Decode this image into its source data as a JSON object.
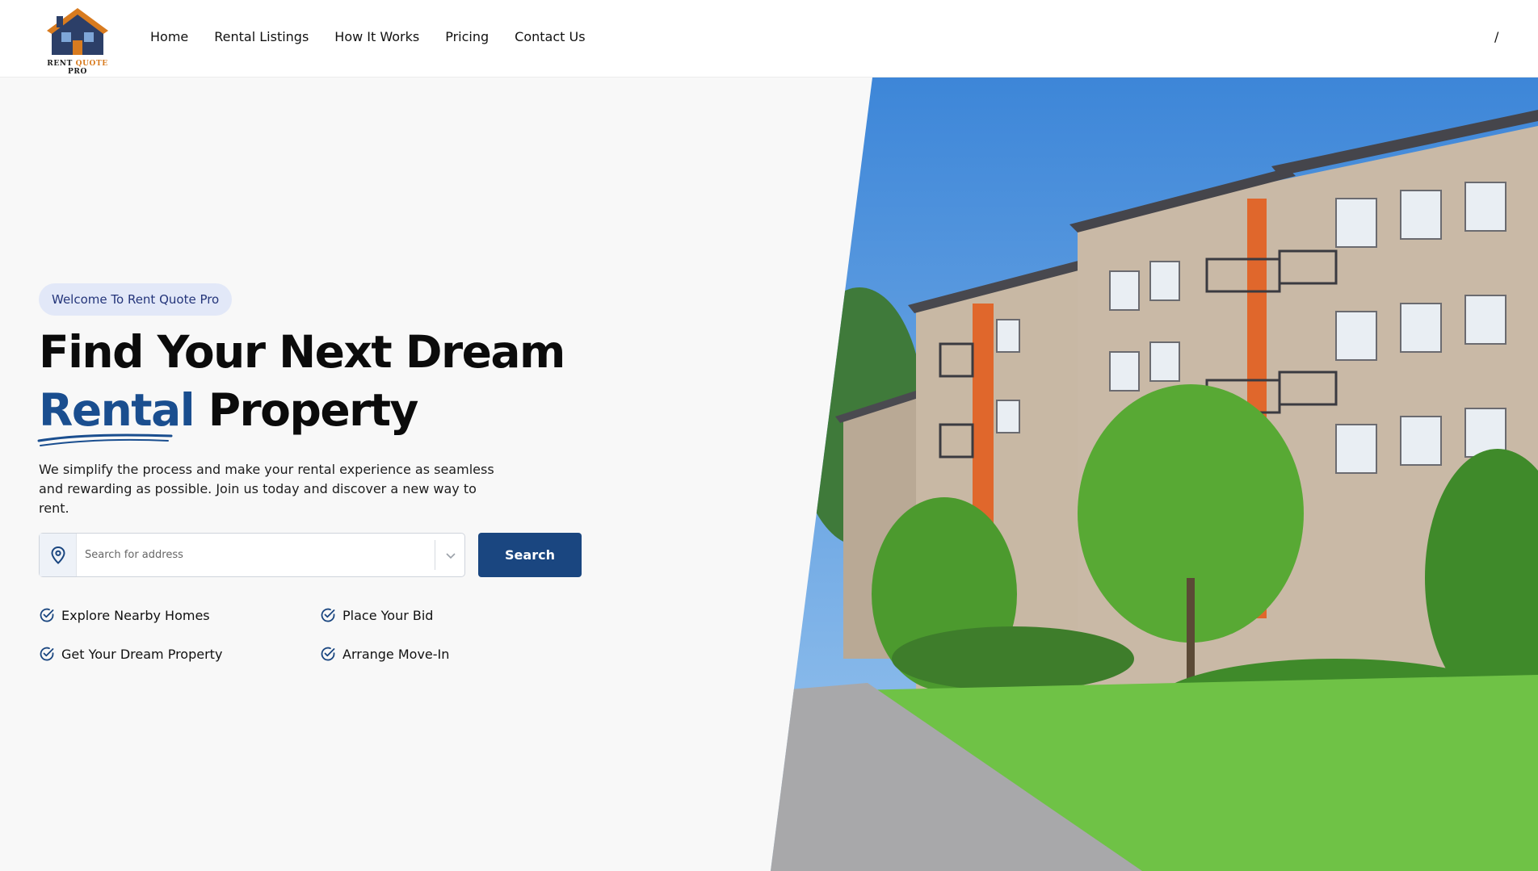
{
  "header": {
    "logo": {
      "word1": "RENT",
      "word2": "QUOTE",
      "word3": "PRO"
    },
    "nav": [
      "Home",
      "Rental Listings",
      "How It Works",
      "Pricing",
      "Contact Us"
    ],
    "right_text": "/"
  },
  "hero": {
    "badge": "Welcome To Rent Quote Pro",
    "headline_line1": "Find Your Next Dream",
    "headline_accent": "Rental",
    "headline_rest": "Property",
    "description": "We simplify the process and make your rental experience as seamless and rewarding as possible. Join us today and discover a new way to rent.",
    "search": {
      "placeholder": "Search for address",
      "button": "Search"
    },
    "features": [
      "Explore Nearby Homes",
      "Place Your Bid",
      "Get Your Dream Property",
      "Arrange Move-In"
    ]
  },
  "colors": {
    "primary": "#1a4680",
    "accent": "#1a4e8f",
    "badge_bg": "#e2e8f8",
    "logo_orange": "#d87b1f"
  },
  "icons": [
    "house-logo-icon",
    "location-pin-icon",
    "chevron-down-icon",
    "check-circle-icon"
  ]
}
